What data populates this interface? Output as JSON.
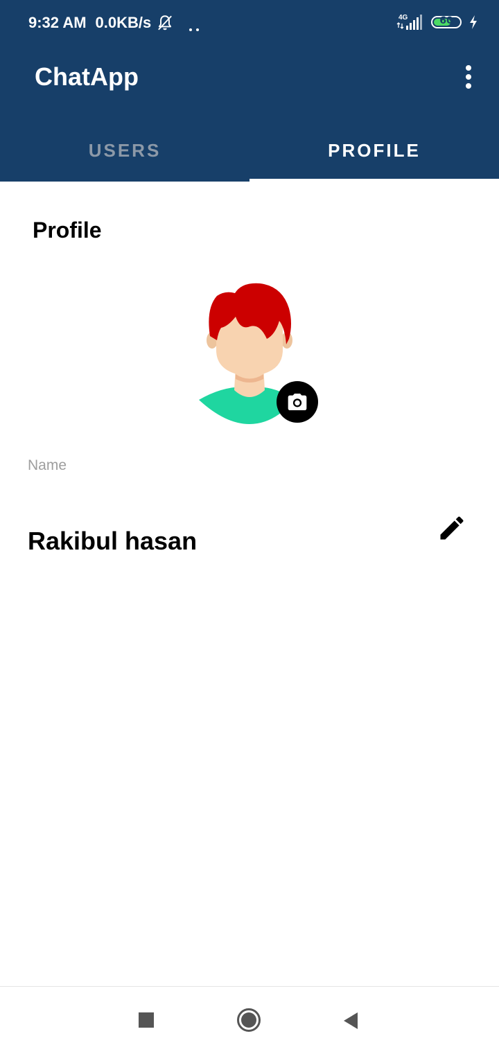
{
  "status_bar": {
    "time": "9:32 AM",
    "network_speed": "0.0KB/s",
    "network_type": "4G",
    "battery_level": "60",
    "icons": [
      "bell-off-icon",
      "more-notifications-dots-icon",
      "signal-icon",
      "battery-icon",
      "charging-icon"
    ]
  },
  "app_bar": {
    "title": "ChatApp",
    "menu_icon": "more-vert-icon",
    "background_color": "#173F69"
  },
  "tabs": [
    {
      "label": "USERS",
      "selected": false
    },
    {
      "label": "PROFILE",
      "selected": true
    }
  ],
  "profile": {
    "heading": "Profile",
    "avatar_icon": "avatar-illustration",
    "camera_icon": "camera-icon",
    "name_label": "Name",
    "name_value": "Rakibul hasan",
    "edit_icon": "pencil-icon"
  },
  "nav_bar": {
    "buttons": [
      "recents-square-icon",
      "home-circle-icon",
      "back-triangle-icon"
    ]
  }
}
